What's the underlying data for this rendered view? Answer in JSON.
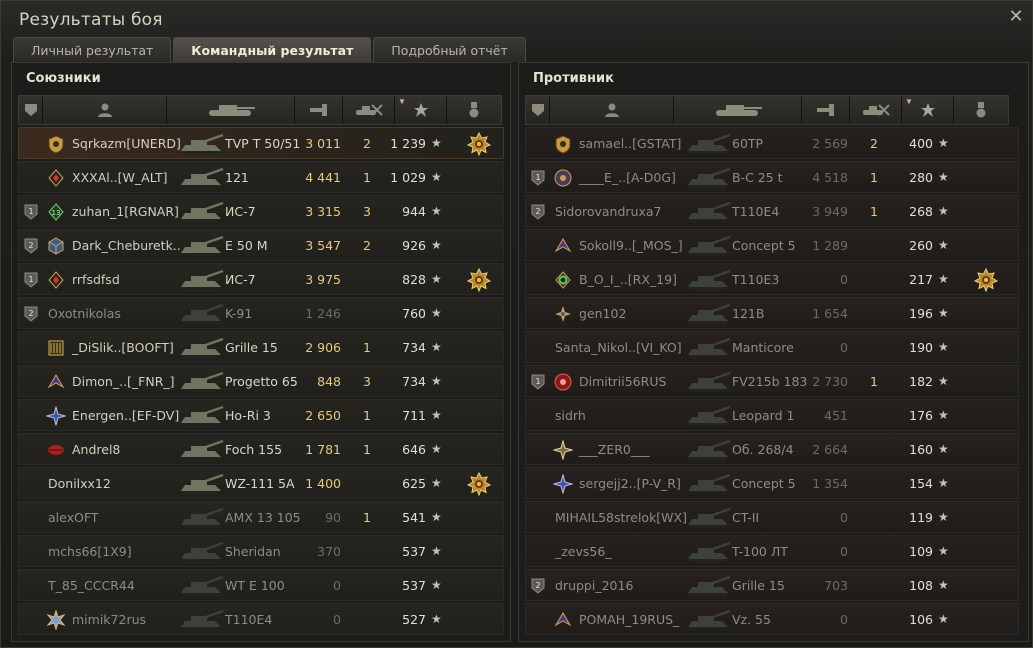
{
  "window": {
    "title": "Результаты боя",
    "close_icon": "close-icon"
  },
  "tabs": [
    {
      "label": "Личный результат",
      "active": false
    },
    {
      "label": "Командный результат",
      "active": true
    },
    {
      "label": "Подробный отчёт",
      "active": false
    }
  ],
  "columns": [
    "platoon",
    "player",
    "tank",
    "damage",
    "kills",
    "experience",
    "medal"
  ],
  "allies": {
    "title": "Союзники",
    "rows": [
      {
        "platoon": "",
        "badge": "gold-shield",
        "player": "Sqrkazm[UNERD]",
        "tank": "TVP T 50/51",
        "damage": "3 011",
        "kills": "2",
        "xp": "1 239",
        "medal": true,
        "self": true,
        "dead": false
      },
      {
        "platoon": "",
        "badge": "red-diamond",
        "player": "XXXAl..[W_ALT]",
        "tank": "121",
        "damage": "4 441",
        "kills": "1",
        "xp": "1 029",
        "medal": false,
        "self": false,
        "dead": false
      },
      {
        "platoon": "1",
        "badge": "green-diamond",
        "player": "zuhan_1[RGNAR]",
        "tank": "ИС-7",
        "damage": "3 315",
        "kills": "3",
        "xp": "944",
        "medal": false,
        "self": false,
        "dead": false
      },
      {
        "platoon": "2",
        "badge": "cube",
        "player": "Dark_Cheburetk..",
        "tank": "E 50 M",
        "damage": "3 547",
        "kills": "2",
        "xp": "926",
        "medal": false,
        "self": false,
        "dead": false
      },
      {
        "platoon": "1",
        "badge": "red-diamond",
        "player": "rrfsdfsd",
        "tank": "ИС-7",
        "damage": "3 975",
        "kills": "",
        "xp": "828",
        "medal": true,
        "self": false,
        "dead": false
      },
      {
        "platoon": "2",
        "badge": "",
        "player": "Oxotnikolas",
        "tank": "K-91",
        "damage": "1 246",
        "kills": "",
        "xp": "760",
        "medal": false,
        "self": false,
        "dead": true
      },
      {
        "platoon": "",
        "badge": "stripes",
        "player": "_DiSlik..[BOOFT]",
        "tank": "Grille 15",
        "damage": "2 906",
        "kills": "1",
        "xp": "734",
        "medal": false,
        "self": false,
        "dead": false
      },
      {
        "platoon": "",
        "badge": "wing",
        "player": "Dimon_..[_FNR_]",
        "tank": "Progetto 65",
        "damage": "848",
        "kills": "3",
        "xp": "734",
        "medal": false,
        "self": false,
        "dead": false
      },
      {
        "platoon": "",
        "badge": "sparkle",
        "player": "Energen..[EF-DV]",
        "tank": "Ho-Ri 3",
        "damage": "2 650",
        "kills": "1",
        "xp": "711",
        "medal": false,
        "self": false,
        "dead": false
      },
      {
        "platoon": "",
        "badge": "red-lips",
        "player": "Andrel8",
        "tank": "Foch 155",
        "damage": "1 781",
        "kills": "1",
        "xp": "646",
        "medal": false,
        "self": false,
        "dead": false
      },
      {
        "platoon": "",
        "badge": "",
        "player": "Donilxx12",
        "tank": "WZ-111 5A",
        "damage": "1 400",
        "kills": "",
        "xp": "625",
        "medal": true,
        "self": false,
        "dead": false
      },
      {
        "platoon": "",
        "badge": "",
        "player": "alexOFT",
        "tank": "AMX 13 105",
        "damage": "90",
        "kills": "1",
        "xp": "541",
        "medal": false,
        "self": false,
        "dead": true
      },
      {
        "platoon": "",
        "badge": "",
        "player": "mchs66[1X9]",
        "tank": "Sheridan",
        "damage": "370",
        "kills": "",
        "xp": "537",
        "medal": false,
        "self": false,
        "dead": true
      },
      {
        "platoon": "",
        "badge": "",
        "player": "T_85_CCCR44",
        "tank": "WT E 100",
        "damage": "0",
        "kills": "",
        "xp": "537",
        "medal": false,
        "self": false,
        "dead": true
      },
      {
        "platoon": "",
        "badge": "star-burst",
        "player": "mimik72rus",
        "tank": "T110E4",
        "damage": "0",
        "kills": "",
        "xp": "527",
        "medal": false,
        "self": false,
        "dead": true
      }
    ]
  },
  "enemies": {
    "title": "Противник",
    "rows": [
      {
        "platoon": "",
        "badge": "gold-shield",
        "player": "samael..[GSTAT]",
        "tank": "60TP",
        "damage": "2 569",
        "kills": "2",
        "xp": "400",
        "medal": false,
        "dead": true
      },
      {
        "platoon": "1",
        "badge": "round-emblem",
        "player": "____E_..[A-D0G]",
        "tank": "B-C 25 t",
        "damage": "4 518",
        "kills": "1",
        "xp": "280",
        "medal": false,
        "dead": true
      },
      {
        "platoon": "2",
        "badge": "",
        "player": "Sidorovandruxa7",
        "tank": "T110E4",
        "damage": "3 949",
        "kills": "1",
        "xp": "268",
        "medal": false,
        "dead": true
      },
      {
        "platoon": "",
        "badge": "wing",
        "player": "Sokoll9..[_MOS_]",
        "tank": "Concept 5",
        "damage": "1 289",
        "kills": "",
        "xp": "260",
        "medal": false,
        "dead": true
      },
      {
        "platoon": "",
        "badge": "green-ring",
        "player": "B_O_I_..[RX_19]",
        "tank": "T110E3",
        "damage": "0",
        "kills": "",
        "xp": "217",
        "medal": true,
        "dead": true
      },
      {
        "platoon": "",
        "badge": "compass",
        "player": "gen102",
        "tank": "121B",
        "damage": "1 654",
        "kills": "",
        "xp": "196",
        "medal": false,
        "dead": true
      },
      {
        "platoon": "",
        "badge": "",
        "player": "Santa_Nikol..[VI_KO]",
        "tank": "Manticore",
        "damage": "0",
        "kills": "",
        "xp": "190",
        "medal": false,
        "dead": true
      },
      {
        "platoon": "1",
        "badge": "red-orb",
        "player": "Dimitrii56RUS",
        "tank": "FV215b 183",
        "damage": "2 730",
        "kills": "1",
        "xp": "182",
        "medal": false,
        "dead": true
      },
      {
        "platoon": "",
        "badge": "",
        "player": "sidrh",
        "tank": "Leopard 1",
        "damage": "451",
        "kills": "",
        "xp": "176",
        "medal": false,
        "dead": true
      },
      {
        "platoon": "",
        "badge": "sparkle-gold",
        "player": "___ZER0___",
        "tank": "Об. 268/4",
        "damage": "2 664",
        "kills": "",
        "xp": "160",
        "medal": false,
        "dead": true
      },
      {
        "platoon": "",
        "badge": "sparkle",
        "player": "sergejj2..[P-V_R]",
        "tank": "Concept 5",
        "damage": "1 354",
        "kills": "",
        "xp": "154",
        "medal": false,
        "dead": true
      },
      {
        "platoon": "",
        "badge": "",
        "player": "MIHAIL58strelok[WX]",
        "tank": "CT-II",
        "damage": "0",
        "kills": "",
        "xp": "119",
        "medal": false,
        "dead": true
      },
      {
        "platoon": "",
        "badge": "",
        "player": "_zevs56_",
        "tank": "T-100 ЛТ",
        "damage": "0",
        "kills": "",
        "xp": "109",
        "medal": false,
        "dead": true
      },
      {
        "platoon": "2",
        "badge": "",
        "player": "druppi_2016",
        "tank": "Grille 15",
        "damage": "703",
        "kills": "",
        "xp": "108",
        "medal": false,
        "dead": true
      },
      {
        "platoon": "",
        "badge": "wing",
        "player": "POMAH_19RUS_",
        "tank": "Vz. 55",
        "damage": "0",
        "kills": "",
        "xp": "106",
        "medal": false,
        "dead": true
      }
    ]
  }
}
